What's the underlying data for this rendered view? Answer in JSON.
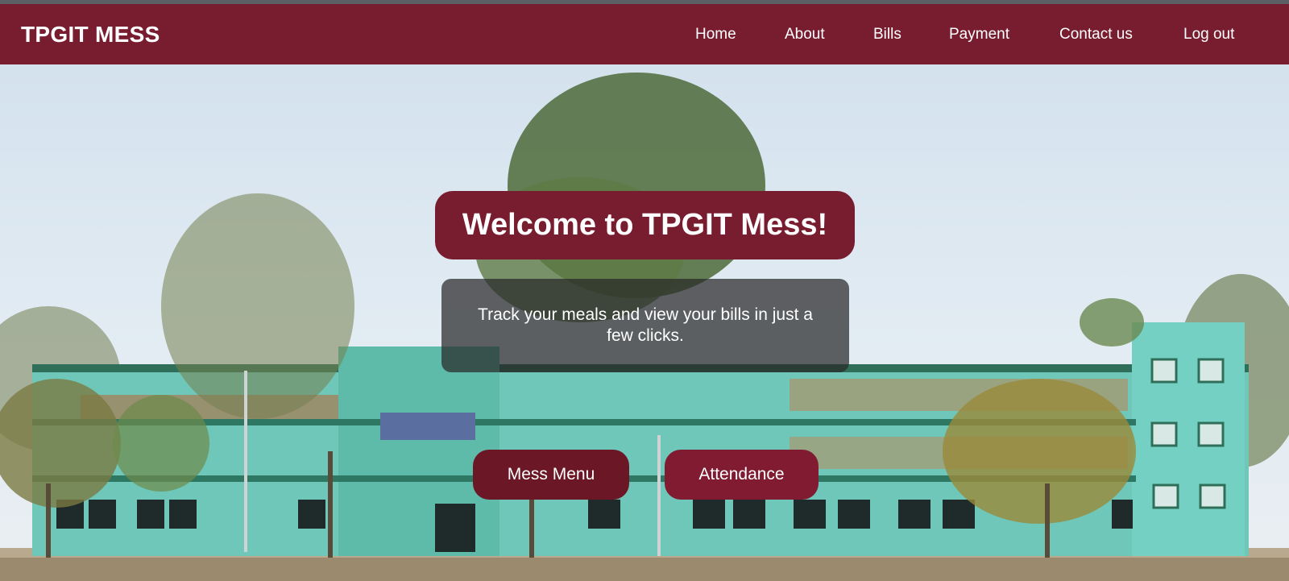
{
  "header": {
    "brand": "TPGIT MESS",
    "nav": [
      {
        "label": "Home"
      },
      {
        "label": "About"
      },
      {
        "label": "Bills"
      },
      {
        "label": "Payment"
      },
      {
        "label": "Contact us"
      },
      {
        "label": "Log out"
      }
    ]
  },
  "hero": {
    "title": "Welcome to TPGIT Mess!",
    "tagline": "Track your meals and view your bills in just a few clicks.",
    "buttons": [
      {
        "label": "Mess Menu"
      },
      {
        "label": "Attendance"
      }
    ],
    "background": "campus-building-photo"
  },
  "colors": {
    "brand": "#781d2f",
    "button_dark": "#6b1726",
    "button": "#801b31",
    "overlay": "#282828"
  }
}
